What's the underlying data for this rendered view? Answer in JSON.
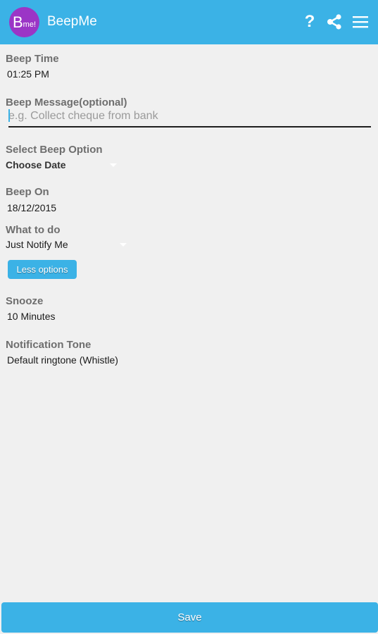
{
  "app_bar": {
    "logo": {
      "main": "B",
      "sub": "me!"
    },
    "title": "BeepMe",
    "help_glyph": "?",
    "icons": [
      "help-icon",
      "share-icon",
      "menu-icon"
    ],
    "color": "#3bb2e6"
  },
  "form": {
    "beep_time": {
      "label": "Beep Time",
      "value": "01:25 PM"
    },
    "beep_message": {
      "label": "Beep Message(optional)",
      "value": "",
      "placeholder": "e.g. Collect cheque from bank"
    },
    "beep_option": {
      "label": "Select Beep Option",
      "selected": "Choose Date"
    },
    "beep_on": {
      "label": "Beep On",
      "value": "18/12/2015"
    },
    "what_to_do": {
      "label": "What to do",
      "selected": "Just Notify Me"
    },
    "less_options_label": "Less options",
    "snooze": {
      "label": "Snooze",
      "value": "10 Minutes"
    },
    "notification_tone": {
      "label": "Notification Tone",
      "value": "Default ringtone (Whistle)"
    }
  },
  "footer": {
    "save_label": "Save"
  },
  "colors": {
    "accent": "#3bb2e6",
    "logo_bg": "#9b35c6",
    "background": "#f0f0f0"
  }
}
